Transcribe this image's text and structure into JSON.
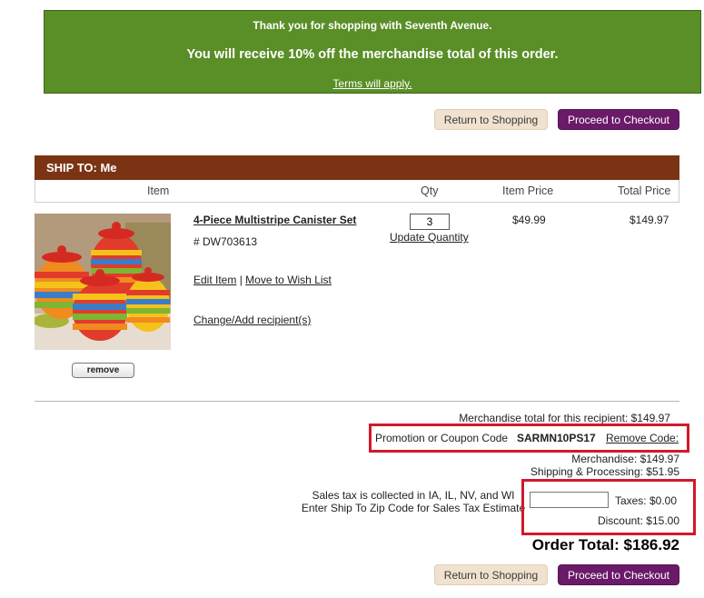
{
  "banner": {
    "line1": "Thank you for shopping with Seventh Avenue.",
    "line2": "You will receive 10% off the merchandise total of this order.",
    "terms_link": "Terms will apply."
  },
  "buttons": {
    "return_label": "Return to Shopping",
    "checkout_label": "Proceed to Checkout"
  },
  "ship_to": {
    "heading": "SHIP TO: Me"
  },
  "table": {
    "headers": {
      "item": "Item",
      "qty": "Qty",
      "item_price": "Item Price",
      "total_price": "Total Price"
    }
  },
  "item": {
    "name": "4-Piece Multistripe Canister Set",
    "sku": "# DW703613",
    "quantity": "3",
    "update_qty": "Update Quantity",
    "item_price": "$49.99",
    "total_price": "$149.97",
    "edit_item": "Edit Item",
    "separator": "|",
    "move_to_wishlist": "Move to Wish List",
    "change_recipient": "Change/Add recipient(s)",
    "remove_label": "remove"
  },
  "summary": {
    "recipient_total": "Merchandise total for this recipient: $149.97",
    "promo_label": "Promotion or Coupon Code",
    "promo_code": "SARMN10PS17",
    "remove_code": "Remove Code:",
    "merchandise": "Merchandise: $149.97",
    "shipping": "Shipping & Processing: $51.95",
    "tax_note_1": "Sales tax is collected in IA, IL, NV, and WI",
    "tax_note_2": "Enter Ship To Zip Code for Sales Tax Estimate",
    "zip_value": "",
    "taxes": "Taxes: $0.00",
    "discount": "Discount: $15.00",
    "order_total": "Order Total: $186.92"
  },
  "colors": {
    "banner_green": "#5a8e27",
    "ship_bar_brown": "#7a3414",
    "checkout_purple": "#6a1a68",
    "return_beige": "#f0e2cf",
    "highlight_red": "#d2192b"
  },
  "icons": {
    "product_image": "canister-set-image"
  }
}
